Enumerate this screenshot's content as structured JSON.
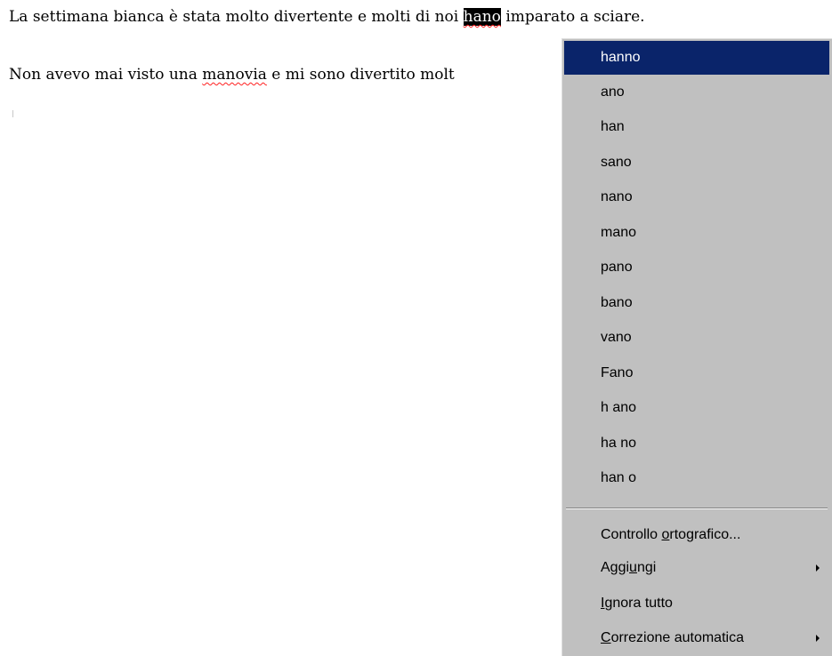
{
  "document": {
    "line1": {
      "before": "La settimana bianca è stata molto divertente e molti di noi ",
      "selected_word": "hano",
      "after": " imparato a sciare."
    },
    "line2": {
      "before": "Non avevo mai visto una ",
      "misspelled_word": "manovia",
      "after": " e mi sono divertito molt"
    }
  },
  "context_menu": {
    "suggestions": [
      "hanno",
      "ano",
      "han",
      "sano",
      "nano",
      "mano",
      "pano",
      "bano",
      "vano",
      "Fano",
      "h ano",
      "ha no",
      "han o"
    ],
    "actions": {
      "spelling": {
        "pre": "Controllo ",
        "key": "o",
        "post": "rtografico..."
      },
      "add": {
        "pre": "Aggi",
        "key": "u",
        "post": "ngi"
      },
      "ignore_all": {
        "pre": "",
        "key": "I",
        "post": "gnora tutto"
      },
      "autocorrect": {
        "pre": "",
        "key": "C",
        "post": "orrezione automatica"
      }
    },
    "submenu_icon": "submenu-arrow-icon",
    "highlight_color": "#0a246a",
    "menu_background": "#c0c0c0",
    "spellcheck_underline_color": "#ff2020"
  }
}
